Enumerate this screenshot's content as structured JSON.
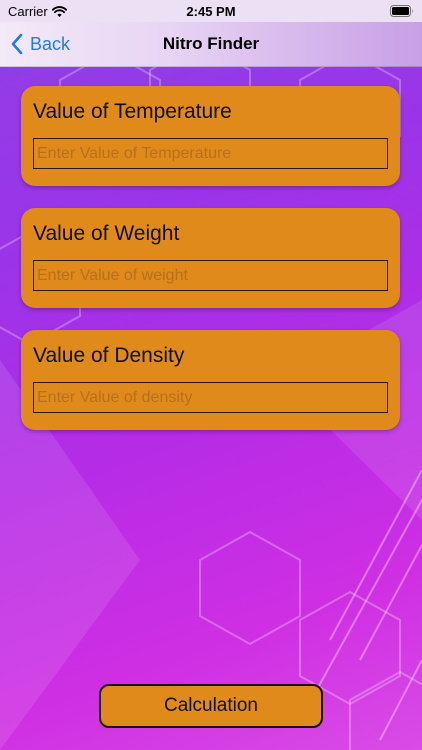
{
  "status_bar": {
    "carrier": "Carrier",
    "time": "2:45 PM",
    "wifi_icon": "wifi-icon",
    "battery_icon": "battery-icon"
  },
  "nav": {
    "back_label": "Back",
    "back_icon": "chevron-left-icon",
    "title": "Nitro Finder"
  },
  "fields": {
    "temperature": {
      "label": "Value of Temperature",
      "value": "",
      "placeholder": "Enter Value of Temperature"
    },
    "weight": {
      "label": "Value of Weight",
      "value": "",
      "placeholder": "Enter Value of weight"
    },
    "density": {
      "label": "Value of Density",
      "value": "",
      "placeholder": "Enter Value of density"
    }
  },
  "actions": {
    "calculate_label": "Calculation"
  },
  "colors": {
    "card_background": "#e08a1c",
    "link_blue": "#1a7cf2",
    "background_purple": "#9b34e8",
    "background_magenta": "#cf2fe3"
  }
}
